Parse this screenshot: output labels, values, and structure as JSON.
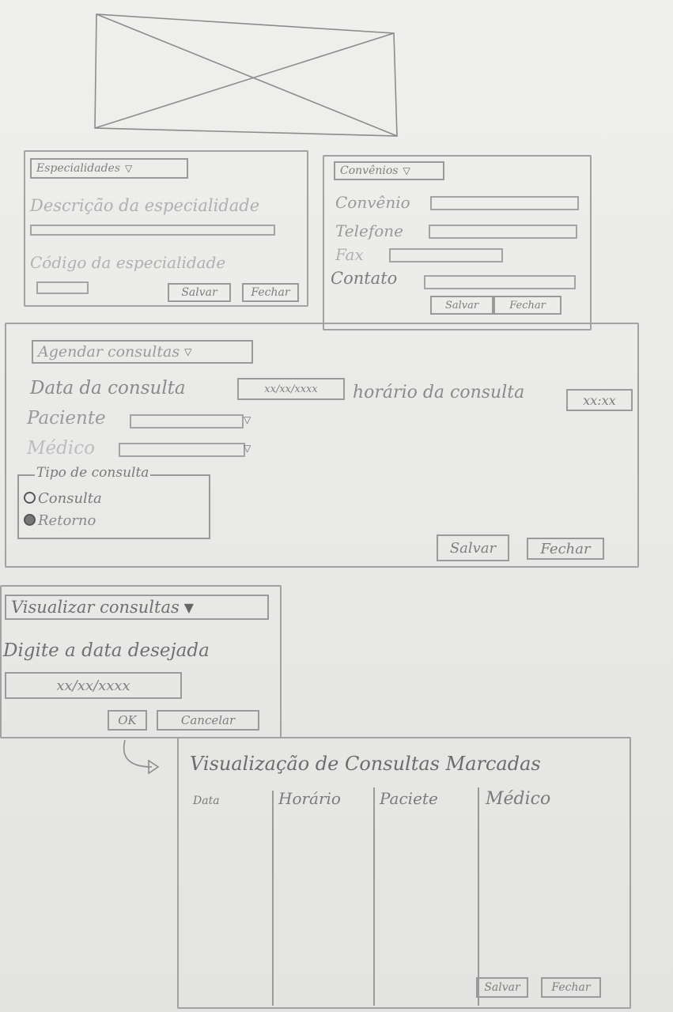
{
  "image_placeholder": {
    "icon": "image-placeholder-icon"
  },
  "especialidades": {
    "dropdown": "Especialidades",
    "descricao_label": "Descrição da especialidade",
    "codigo_label": "Código da especialidade",
    "save": "Salvar",
    "close": "Fechar"
  },
  "convenios": {
    "dropdown": "Convênios",
    "convenio_label": "Convênio",
    "telefone_label": "Telefone",
    "fax_label": "Fax",
    "contato_label": "Contato",
    "save": "Salvar",
    "close": "Fechar"
  },
  "agendar": {
    "dropdown": "Agendar consultas",
    "data_label": "Data da consulta",
    "data_value": "xx/xx/xxxx",
    "horario_label": "horário da consulta",
    "horario_value": "xx:xx",
    "paciente_label": "Paciente",
    "medico_label": "Médico",
    "tipo_legend": "Tipo de consulta",
    "tipo_options": [
      "Consulta",
      "Retorno"
    ],
    "save": "Salvar",
    "close": "Fechar"
  },
  "visualizar": {
    "dropdown": "Visualizar consultas",
    "prompt": "Digite a data desejada",
    "date_value": "xx/xx/xxxx",
    "ok": "OK",
    "cancel": "Cancelar"
  },
  "lista": {
    "title": "Visualização de Consultas Marcadas",
    "columns": [
      "Data",
      "Horário",
      "Paciete",
      "Médico"
    ],
    "save": "Salvar",
    "close": "Fechar"
  }
}
